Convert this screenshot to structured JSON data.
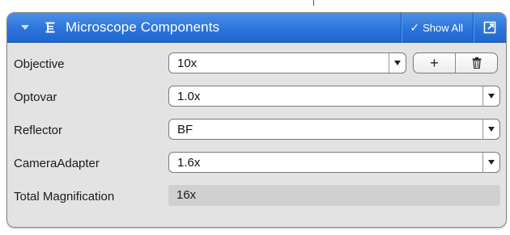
{
  "panel": {
    "title": "Microscope Components",
    "show_all_label": "Show All"
  },
  "rows": [
    {
      "label": "Objective",
      "value": "10x"
    },
    {
      "label": "Optovar",
      "value": "1.0x"
    },
    {
      "label": "Reflector",
      "value": "BF"
    },
    {
      "label": "CameraAdapter",
      "value": "1.6x"
    },
    {
      "label": "Total Magnification",
      "value": "16x"
    }
  ],
  "objective_buttons": {
    "add": "+"
  },
  "colors": {
    "header_blue": "#2c74db",
    "panel_bg": "#e3e3e3",
    "readonly_bg": "#d0d0d0"
  },
  "icons": {
    "collapse": "triangle-down-icon",
    "panel": "microscope-panel-icon",
    "check": "checkmark-icon",
    "popout": "popout-window-icon",
    "dropdown": "chevron-down-icon",
    "add": "plus-icon",
    "delete": "trash-icon"
  }
}
